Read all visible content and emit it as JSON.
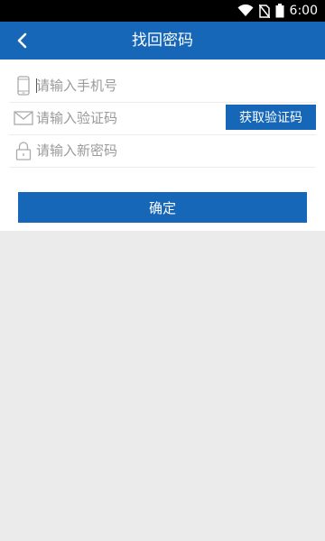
{
  "status_bar": {
    "time": "6:00",
    "icons": [
      "wifi-icon",
      "no-sim-icon",
      "battery-icon"
    ]
  },
  "app_bar": {
    "title": "找回密码",
    "back_icon": "chevron-left-icon"
  },
  "form": {
    "phone": {
      "icon": "phone-icon",
      "placeholder": "请输入手机号",
      "value": ""
    },
    "code": {
      "icon": "envelope-icon",
      "placeholder": "请输入验证码",
      "value": "",
      "button_label": "获取验证码"
    },
    "new_password": {
      "icon": "lock-icon",
      "placeholder": "请输入新密码",
      "value": ""
    },
    "confirm_label": "确定"
  },
  "colors": {
    "primary": "#1667b8",
    "background": "#ebebeb",
    "placeholder": "#9a9a9a",
    "icon": "#aaaaaa"
  }
}
